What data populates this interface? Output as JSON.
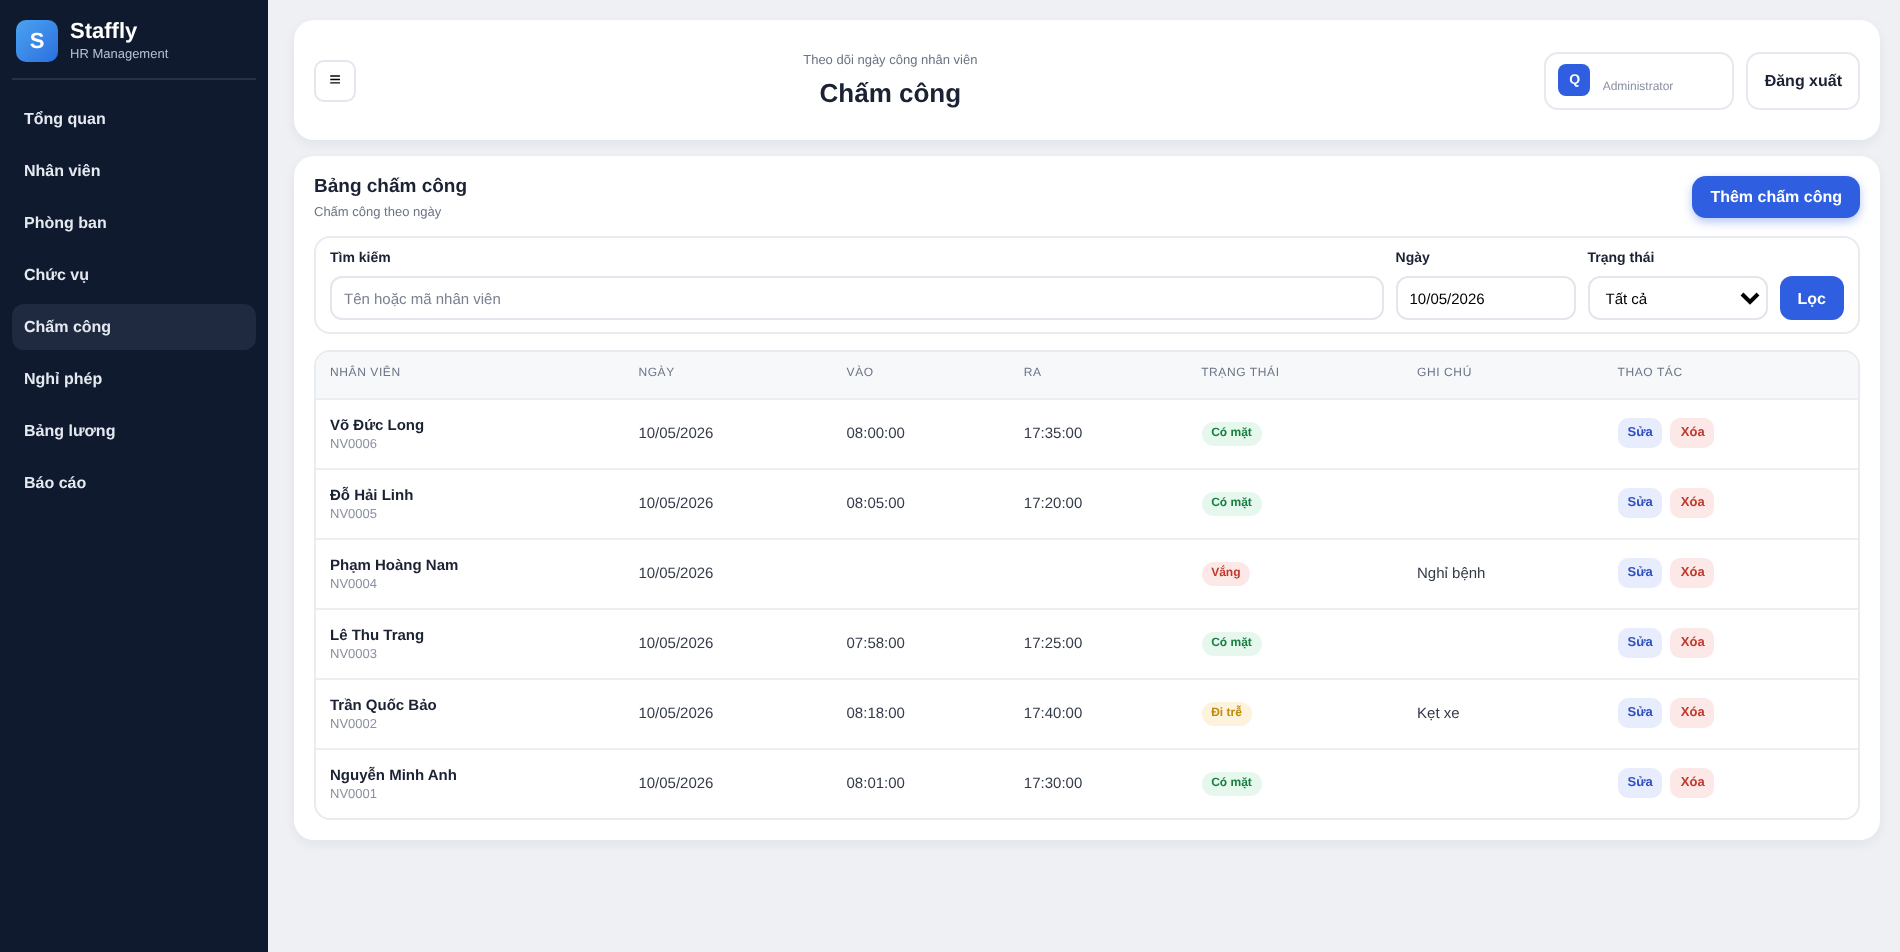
{
  "sidebar": {
    "brand": {
      "logo": "S",
      "name": "Staffly",
      "subtitle": "HR Management"
    },
    "items": [
      {
        "label": "Tổng quan",
        "selected": false
      },
      {
        "label": "Nhân viên",
        "selected": false
      },
      {
        "label": "Phòng ban",
        "selected": false
      },
      {
        "label": "Chức vụ",
        "selected": false
      },
      {
        "label": "Chấm công",
        "selected": true
      },
      {
        "label": "Nghỉ phép",
        "selected": false
      },
      {
        "label": "Bảng lương",
        "selected": false
      },
      {
        "label": "Báo cáo",
        "selected": false
      }
    ]
  },
  "header": {
    "menu_button": "≡",
    "subtitle": "Theo dõi ngày công nhân viên",
    "title": "Chấm công",
    "user": {
      "avatar": "Q",
      "role": "Administrator"
    },
    "logout": "Đăng xuất"
  },
  "panel": {
    "title": "Bảng chấm công",
    "subtitle": "Chấm công theo ngày",
    "add_button": "Thêm chấm công"
  },
  "filters": {
    "search": {
      "label": "Tìm kiếm",
      "placeholder": "Tên hoặc mã nhân viên"
    },
    "date": {
      "label": "Ngày",
      "value": "10/05/2026"
    },
    "status": {
      "label": "Trạng thái",
      "value": "Tất cả"
    },
    "filter_button": "Lọc"
  },
  "table": {
    "columns": [
      "NHÂN VIÊN",
      "NGÀY",
      "VÀO",
      "RA",
      "TRẠNG THÁI",
      "GHI CHÚ",
      "THAO TÁC"
    ],
    "rows": [
      {
        "name": "Võ Đức Long",
        "code": "NV0006",
        "date": "10/05/2026",
        "in": "08:00:00",
        "out": "17:35:00",
        "status": {
          "kind": "present",
          "label": "Có mặt"
        },
        "edit": "Sửa",
        "delete": "Xóa"
      },
      {
        "name": "Đỗ Hải Linh",
        "code": "NV0005",
        "date": "10/05/2026",
        "in": "08:05:00",
        "out": "17:20:00",
        "status": {
          "kind": "present",
          "label": "Có mặt"
        },
        "edit": "Sửa",
        "delete": "Xóa"
      },
      {
        "name": "Phạm Hoàng Nam",
        "code": "NV0004",
        "date": "10/05/2026",
        "status": {
          "kind": "absent",
          "label": "Vắng"
        },
        "note": "Nghỉ bệnh",
        "edit": "Sửa",
        "delete": "Xóa"
      },
      {
        "name": "Lê Thu Trang",
        "code": "NV0003",
        "date": "10/05/2026",
        "in": "07:58:00",
        "out": "17:25:00",
        "status": {
          "kind": "present",
          "label": "Có mặt"
        },
        "edit": "Sửa",
        "delete": "Xóa"
      },
      {
        "name": "Trần Quốc Bảo",
        "code": "NV0002",
        "date": "10/05/2026",
        "in": "08:18:00",
        "out": "17:40:00",
        "status": {
          "kind": "late",
          "label": "Đi trễ"
        },
        "note": "Kẹt xe",
        "edit": "Sửa",
        "delete": "Xóa"
      },
      {
        "name": "Nguyễn Minh Anh",
        "code": "NV0001",
        "date": "10/05/2026",
        "in": "08:01:00",
        "out": "17:30:00",
        "status": {
          "kind": "present",
          "label": "Có mặt"
        },
        "edit": "Sửa",
        "delete": "Xóa"
      }
    ]
  }
}
